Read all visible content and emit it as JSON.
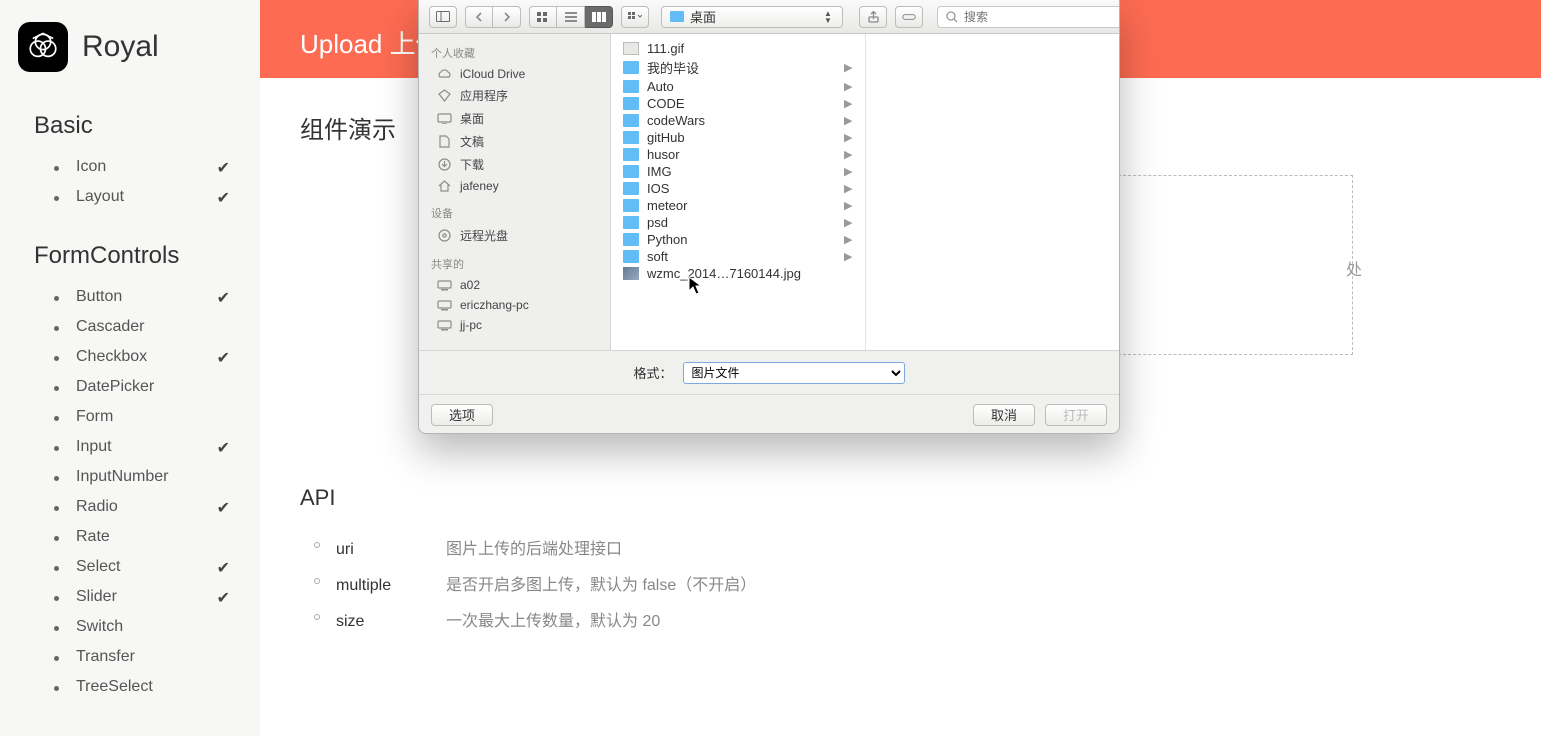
{
  "brand": {
    "name": "Royal"
  },
  "nav": {
    "sections": [
      {
        "title": "Basic",
        "items": [
          {
            "label": "Icon",
            "checked": true
          },
          {
            "label": "Layout",
            "checked": true
          }
        ]
      },
      {
        "title": "FormControls",
        "items": [
          {
            "label": "Button",
            "checked": true
          },
          {
            "label": "Cascader",
            "checked": false
          },
          {
            "label": "Checkbox",
            "checked": true
          },
          {
            "label": "DatePicker",
            "checked": false
          },
          {
            "label": "Form",
            "checked": false
          },
          {
            "label": "Input",
            "checked": true
          },
          {
            "label": "InputNumber",
            "checked": false
          },
          {
            "label": "Radio",
            "checked": true
          },
          {
            "label": "Rate",
            "checked": false
          },
          {
            "label": "Select",
            "checked": true
          },
          {
            "label": "Slider",
            "checked": true
          },
          {
            "label": "Switch",
            "checked": false
          },
          {
            "label": "Transfer",
            "checked": false
          },
          {
            "label": "TreeSelect",
            "checked": false
          }
        ]
      }
    ]
  },
  "page": {
    "hero_title": "Upload 上传",
    "section_demo": "组件演示",
    "dropzone_text": "处",
    "api_title": "API",
    "api": [
      {
        "key": "uri",
        "desc": "图片上传的后端处理接口"
      },
      {
        "key": "multiple",
        "desc": "是否开启多图上传，默认为 false（不开启）"
      },
      {
        "key": "size",
        "desc": "一次最大上传数量，默认为 20"
      }
    ]
  },
  "finder": {
    "path_label": "桌面",
    "search_placeholder": "搜索",
    "side": {
      "favorites_label": "个人收藏",
      "favorites": [
        {
          "label": "iCloud Drive",
          "icon": "cloud"
        },
        {
          "label": "应用程序",
          "icon": "apps"
        },
        {
          "label": "桌面",
          "icon": "desktop"
        },
        {
          "label": "文稿",
          "icon": "doc"
        },
        {
          "label": "下载",
          "icon": "download"
        },
        {
          "label": "jafeney",
          "icon": "home"
        }
      ],
      "devices_label": "设备",
      "devices": [
        {
          "label": "远程光盘",
          "icon": "disc"
        }
      ],
      "shared_label": "共享的",
      "shared": [
        {
          "label": "a02",
          "icon": "pc"
        },
        {
          "label": "ericzhang-pc",
          "icon": "pc"
        },
        {
          "label": "jj-pc",
          "icon": "pc"
        }
      ]
    },
    "files": [
      {
        "name": "111.gif",
        "type": "gif"
      },
      {
        "name": "我的毕设",
        "type": "folder"
      },
      {
        "name": "Auto",
        "type": "folder"
      },
      {
        "name": "CODE",
        "type": "folder"
      },
      {
        "name": "codeWars",
        "type": "folder"
      },
      {
        "name": "gitHub",
        "type": "folder"
      },
      {
        "name": "husor",
        "type": "folder"
      },
      {
        "name": "IMG",
        "type": "folder"
      },
      {
        "name": "IOS",
        "type": "folder"
      },
      {
        "name": "meteor",
        "type": "folder"
      },
      {
        "name": "psd",
        "type": "folder"
      },
      {
        "name": "Python",
        "type": "folder"
      },
      {
        "name": "soft",
        "type": "folder"
      },
      {
        "name": "wzmc_2014…7160144.jpg",
        "type": "jpg"
      }
    ],
    "format_label": "格式：",
    "format_value": "图片文件",
    "options_btn": "选项",
    "cancel_btn": "取消",
    "open_btn": "打开"
  }
}
